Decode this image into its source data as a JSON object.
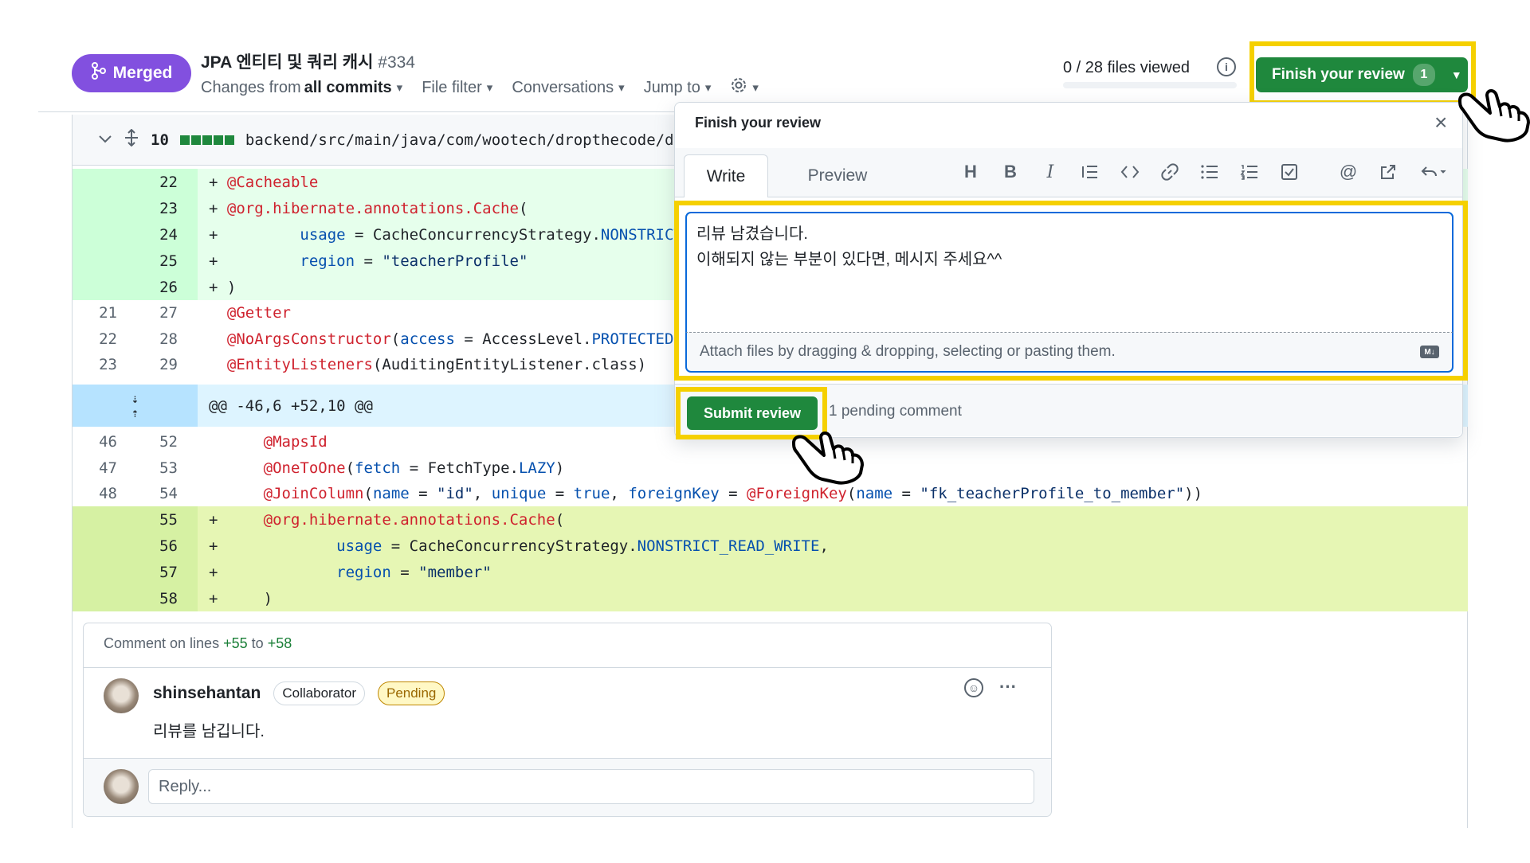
{
  "header": {
    "status_badge": "Merged",
    "title": "JPA 엔티티 및 쿼리 캐시",
    "number": "#334",
    "subnav": {
      "changes_from": "Changes from",
      "all_commits": "all commits",
      "file_filter": "File filter",
      "conversations": "Conversations",
      "jump_to": "Jump to"
    },
    "files_viewed": "0 / 28 files viewed",
    "finish_review": "Finish your review",
    "pending_count": "1"
  },
  "file": {
    "changes": "10",
    "path": "backend/src/main/java/com/wootech/dropthecode/do"
  },
  "diff_rows": [
    {
      "old": "",
      "new": "22",
      "code": "+ @Cacheable"
    },
    {
      "old": "",
      "new": "23",
      "code": "+ @org.hibernate.annotations.Cache("
    },
    {
      "old": "",
      "new": "24",
      "code": "+         usage = CacheConcurrencyStrategy.NONSTRICT"
    },
    {
      "old": "",
      "new": "25",
      "code": "+         region = \"teacherProfile\""
    },
    {
      "old": "",
      "new": "26",
      "code": "+ )"
    },
    {
      "old": "21",
      "new": "27",
      "code": "  @Getter"
    },
    {
      "old": "22",
      "new": "28",
      "code": "  @NoArgsConstructor(access = AccessLevel.PROTECTED)"
    },
    {
      "old": "23",
      "new": "29",
      "code": "  @EntityListeners(AuditingEntityListener.class)"
    },
    {
      "old": "",
      "new": "",
      "code": "@@ -46,6 +52,10 @@"
    },
    {
      "old": "46",
      "new": "52",
      "code": "      @MapsId"
    },
    {
      "old": "47",
      "new": "53",
      "code": "      @OneToOne(fetch = FetchType.LAZY)"
    },
    {
      "old": "48",
      "new": "54",
      "code": "      @JoinColumn(name = \"id\", unique = true, foreignKey = @ForeignKey(name = \"fk_teacherProfile_to_member\"))"
    },
    {
      "old": "",
      "new": "55",
      "code": "+     @org.hibernate.annotations.Cache("
    },
    {
      "old": "",
      "new": "56",
      "code": "+             usage = CacheConcurrencyStrategy.NONSTRICT_READ_WRITE,"
    },
    {
      "old": "",
      "new": "57",
      "code": "+             region = \"member\""
    },
    {
      "old": "",
      "new": "58",
      "code": "+     )"
    }
  ],
  "comment": {
    "on_lines_prefix": "Comment on lines",
    "from": "+55",
    "to_word": "to",
    "to": "+58",
    "author": "shinsehantan",
    "role_badge": "Collaborator",
    "pending_badge": "Pending",
    "body": "리뷰를 남깁니다.",
    "reply_placeholder": "Reply..."
  },
  "review_popover": {
    "title": "Finish your review",
    "tab_write": "Write",
    "tab_preview": "Preview",
    "toolbar_icons": [
      "heading-icon",
      "bold-icon",
      "italic-icon",
      "quote-icon",
      "code-icon",
      "link-icon",
      "unordered-list-icon",
      "ordered-list-icon",
      "task-list-icon",
      "mention-icon",
      "cross-reference-icon",
      "saved-reply-icon"
    ],
    "textarea_value": "리뷰 남겼습니다.\n이해되지 않는 부분이 있다면, 메시지 주세요^^",
    "attach_hint": "Attach files by dragging & dropping, selecting or pasting them.",
    "markdown_label": "M↓",
    "submit": "Submit review",
    "pending_comments": "1 pending comment"
  },
  "colors": {
    "merged": "#8250df",
    "primary_button": "#1f883d",
    "highlight": "#f5d000",
    "addition_bg": "#e6ffec"
  }
}
